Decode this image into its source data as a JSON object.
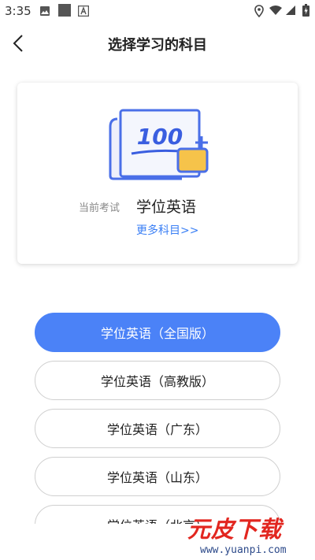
{
  "status_bar": {
    "time": "3:35",
    "left_icons": [
      "image-icon",
      "square-icon",
      "font-icon"
    ],
    "right_icons": [
      "location-icon",
      "wifi-icon",
      "signal-icon",
      "battery-icon"
    ]
  },
  "header": {
    "title": "选择学习的科目",
    "back_icon": "chevron-left-icon"
  },
  "exam_card": {
    "illustration_text": "100",
    "current_label": "当前考试",
    "current_subject": "学位英语",
    "more_link": "更多科目>>"
  },
  "subjects": [
    {
      "label": "学位英语（全国版）",
      "selected": true
    },
    {
      "label": "学位英语（高教版）",
      "selected": false
    },
    {
      "label": "学位英语（广东）",
      "selected": false
    },
    {
      "label": "学位英语（山东）",
      "selected": false
    },
    {
      "label": "学位英语（北京）",
      "selected": false
    }
  ],
  "watermark": {
    "title": "元皮下载",
    "url": "www.yuanpi.com"
  },
  "colors": {
    "accent": "#4b82f7",
    "link": "#3a7ff5",
    "watermark_red": "#e2261f",
    "illustration_yellow": "#f6c34a"
  }
}
